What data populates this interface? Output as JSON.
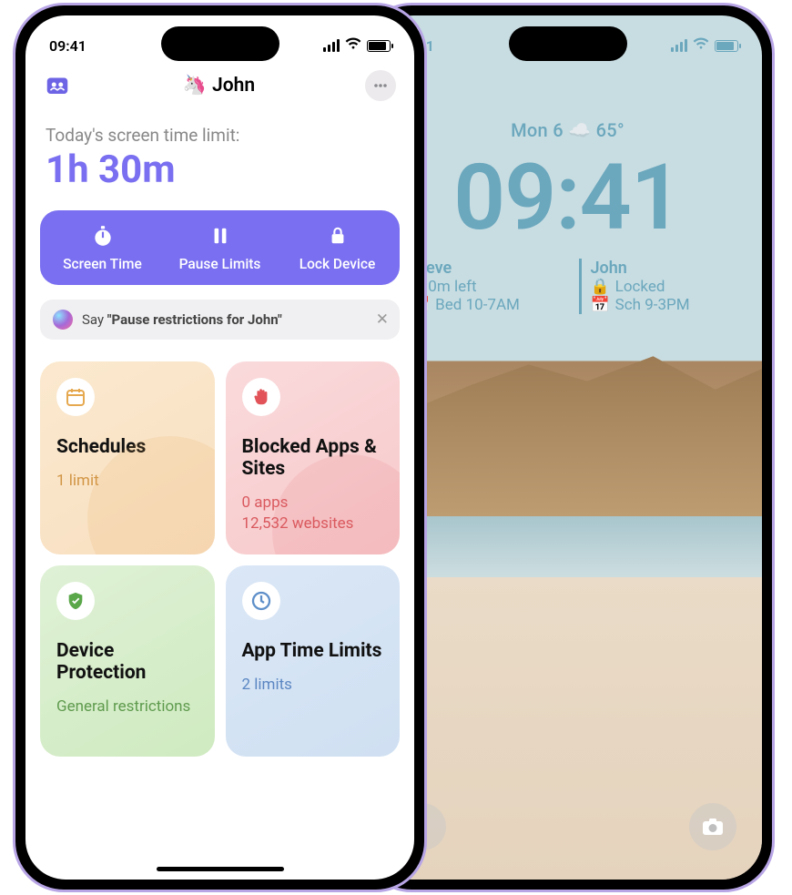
{
  "status_time": "09:41",
  "app": {
    "profile_name": "John",
    "profile_emoji": "🦄",
    "limit_label": "Today's screen time limit:",
    "limit_value": "1h 30m",
    "actions": {
      "screen_time": "Screen Time",
      "pause_limits": "Pause Limits",
      "lock_device": "Lock Device"
    },
    "siri": {
      "prefix": "Say ",
      "phrase": "\"Pause restrictions for John\""
    },
    "cards": {
      "schedules": {
        "title": "Schedules",
        "sub": "1 limit"
      },
      "blocked": {
        "title": "Blocked Apps & Sites",
        "sub1": "0 apps",
        "sub2": "12,532 websites"
      },
      "protection": {
        "title": "Device Protection",
        "sub": "General restrictions"
      },
      "app_limits": {
        "title": "App Time Limits",
        "sub": "2 limits"
      }
    }
  },
  "lock": {
    "date": "Mon 6 ☁️ 65°",
    "time": "09:41",
    "widgets": [
      {
        "name": "Steve",
        "row1_icon": "⏱",
        "row1": "0m left",
        "row2_icon": "📅",
        "row2": "Bed 10-7AM"
      },
      {
        "name": "John",
        "row1_icon": "🔒",
        "row1": "Locked",
        "row2_icon": "📅",
        "row2": "Sch 9-3PM"
      }
    ]
  },
  "colors": {
    "accent": "#7a6ff0",
    "lock_tint": "#6ba7bd"
  }
}
